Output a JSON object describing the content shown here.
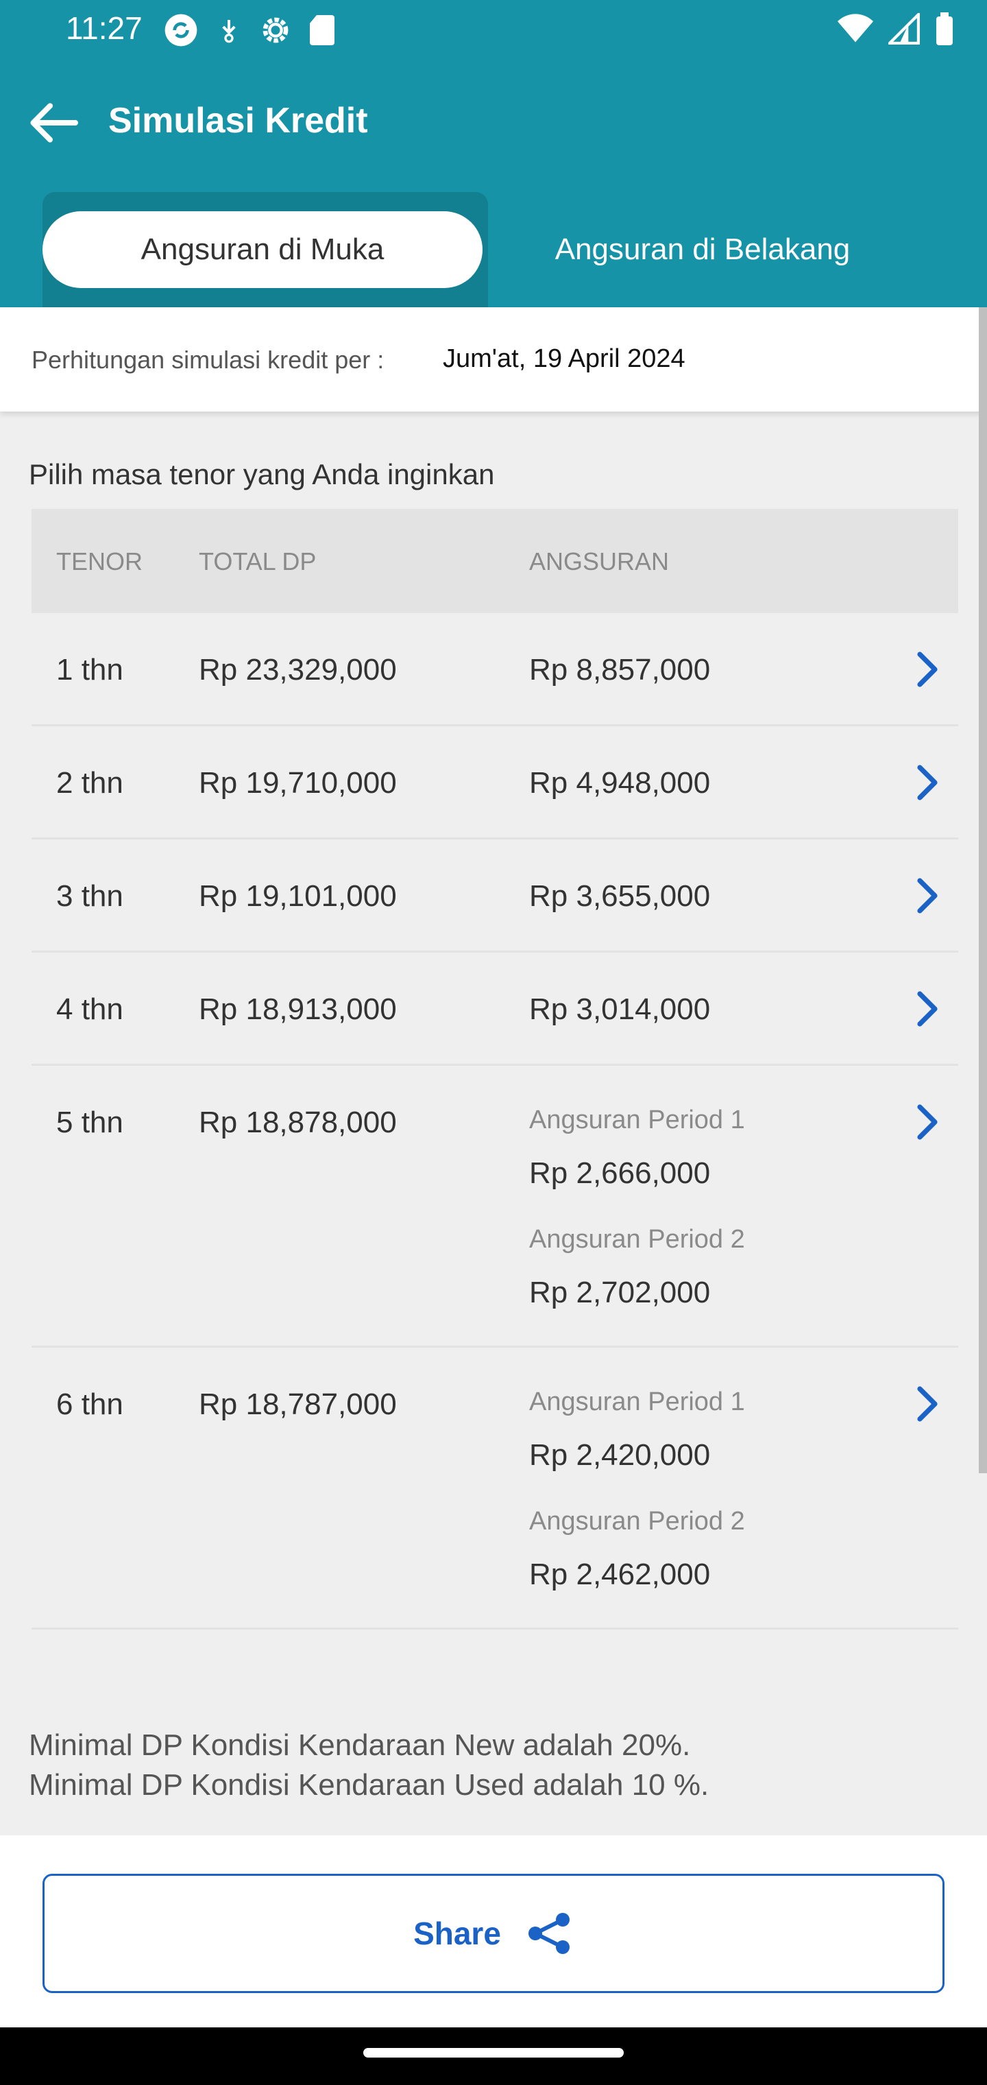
{
  "status_bar": {
    "time": "11:27",
    "left_icons": [
      "refresh-app-icon",
      "download-icon",
      "settings-icon",
      "sd-card-icon"
    ],
    "right_icons": [
      "wifi-icon",
      "signal-icon",
      "battery-icon"
    ]
  },
  "app_bar": {
    "title": "Simulasi Kredit",
    "back_icon": "arrow-left-icon"
  },
  "tabs": [
    {
      "label": "Angsuran di Muka",
      "active": true
    },
    {
      "label": "Angsuran di Belakang",
      "active": false
    }
  ],
  "date_info": {
    "label": "Perhitungan simulasi kredit per :",
    "value": "Jum'at, 19 April 2024"
  },
  "section_title": "Pilih masa tenor yang Anda inginkan",
  "table": {
    "headers": {
      "tenor": "TENOR",
      "total_dp": "TOTAL DP",
      "angsuran": "ANGSURAN"
    },
    "rows": [
      {
        "tenor": "1 thn",
        "total_dp": "Rp 23,329,000",
        "angsuran": "Rp 8,857,000"
      },
      {
        "tenor": "2 thn",
        "total_dp": "Rp 19,710,000",
        "angsuran": "Rp 4,948,000"
      },
      {
        "tenor": "3 thn",
        "total_dp": "Rp 19,101,000",
        "angsuran": "Rp 3,655,000"
      },
      {
        "tenor": "4 thn",
        "total_dp": "Rp 18,913,000",
        "angsuran": "Rp 3,014,000"
      },
      {
        "tenor": "5 thn",
        "total_dp": "Rp 18,878,000",
        "period1_label": "Angsuran Period 1",
        "period1_value": "Rp 2,666,000",
        "period2_label": "Angsuran Period 2",
        "period2_value": "Rp 2,702,000"
      },
      {
        "tenor": "6 thn",
        "total_dp": "Rp 18,787,000",
        "period1_label": "Angsuran Period 1",
        "period1_value": "Rp 2,420,000",
        "period2_label": "Angsuran Period 2",
        "period2_value": "Rp 2,462,000"
      }
    ]
  },
  "notes": {
    "line1": "Minimal DP Kondisi Kendaraan New adalah 20%.",
    "line2": "Minimal DP Kondisi Kendaraan Used adalah 10 %."
  },
  "share_button": {
    "label": "Share",
    "icon": "share-icon"
  },
  "colors": {
    "header": "#1793a8",
    "tab_track": "#138091",
    "accent_blue": "#1a62c6",
    "chevron": "#1a62c6"
  }
}
